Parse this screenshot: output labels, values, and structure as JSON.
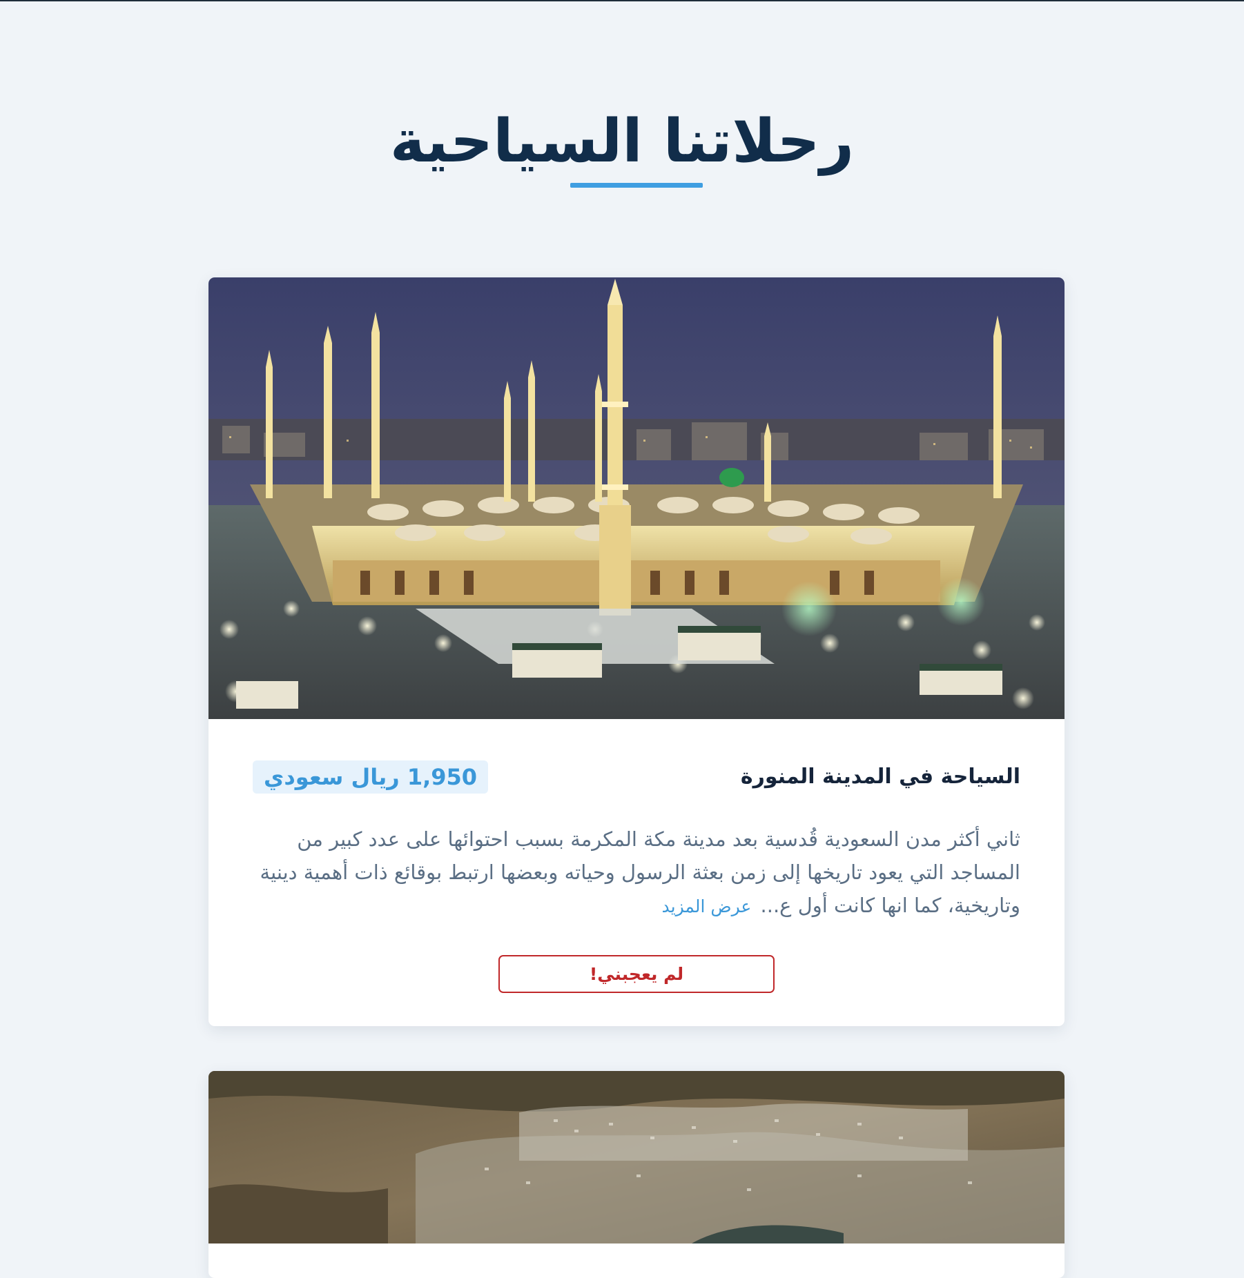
{
  "page": {
    "title": "رحلاتنا السياحية"
  },
  "trips": [
    {
      "image_alt": "المسجد النبوي ليلاً",
      "title": "السياحة في المدينة المنورة",
      "price": "1,950 ريال سعودي",
      "description": "ثاني أكثر مدن السعودية قُدسية بعد مدينة مكة المكرمة بسبب احتوائها على عدد كبير من المساجد التي يعود تاريخها إلى زمن بعثة الرسول وحياته وبعضها ارتبط بوقائع ذات أهمية دينية وتاريخية، كما انها كانت أول ع...",
      "read_more": "عرض المزيد",
      "dislike_label": "لم يعجبني!"
    },
    {
      "image_alt": "منظر جوي لمدينة جبلية"
    }
  ],
  "colors": {
    "accent": "#3f9ee1",
    "title": "#112d4a",
    "danger": "#c0282a",
    "background": "#f0f4f8"
  }
}
